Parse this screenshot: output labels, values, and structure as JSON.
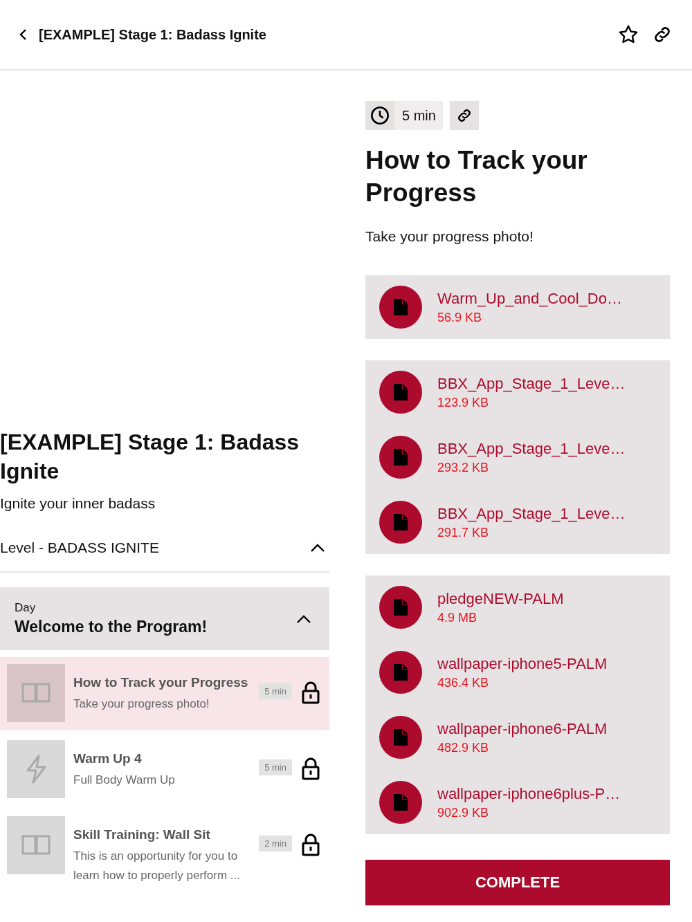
{
  "header": {
    "title": "[EXAMPLE] Stage 1: Badass Ignite"
  },
  "program": {
    "title": "[EXAMPLE] Stage 1: Badass Ignite",
    "subtitle": "Ignite your inner badass",
    "level": {
      "label": "Level - BADASS IGNITE",
      "expanded": true
    },
    "day": {
      "label": "Day",
      "title": "Welcome to the Program!",
      "expanded": true
    }
  },
  "lessons": [
    {
      "kind": "reading",
      "title": "How to Track your Progress",
      "description": "Take your progress photo!",
      "duration": "5 min",
      "locked": true,
      "selected": true
    },
    {
      "kind": "workout",
      "title": "Warm Up 4",
      "description": "Full Body Warm Up",
      "duration": "5 min",
      "locked": true,
      "selected": false
    },
    {
      "kind": "reading",
      "title": "Skill Training: Wall Sit",
      "description": "This is an opportunity for you to learn how to properly perform ...",
      "duration": "2 min",
      "locked": true,
      "selected": false
    }
  ],
  "lesson": {
    "duration": "5 min",
    "title": "How to Track your Progress",
    "description": "Take your progress photo!"
  },
  "file_groups": [
    [
      {
        "name": "Warm_Up_and_Cool_Do…",
        "size": "56.9 KB"
      }
    ],
    [
      {
        "name": "BBX_App_Stage_1_Leve…",
        "size": "123.9 KB"
      },
      {
        "name": "BBX_App_Stage_1_Leve…",
        "size": "293.2 KB"
      },
      {
        "name": "BBX_App_Stage_1_Leve…",
        "size": "291.7 KB"
      }
    ],
    [
      {
        "name": "pledgeNEW-PALM",
        "size": "4.9 MB"
      },
      {
        "name": "wallpaper-iphone5-PALM",
        "size": "436.4 KB"
      },
      {
        "name": "wallpaper-iphone6-PALM",
        "size": "482.9 KB"
      },
      {
        "name": "wallpaper-iphone6plus-P…",
        "size": "902.9 KB"
      }
    ]
  ],
  "complete_button": "COMPLETE"
}
